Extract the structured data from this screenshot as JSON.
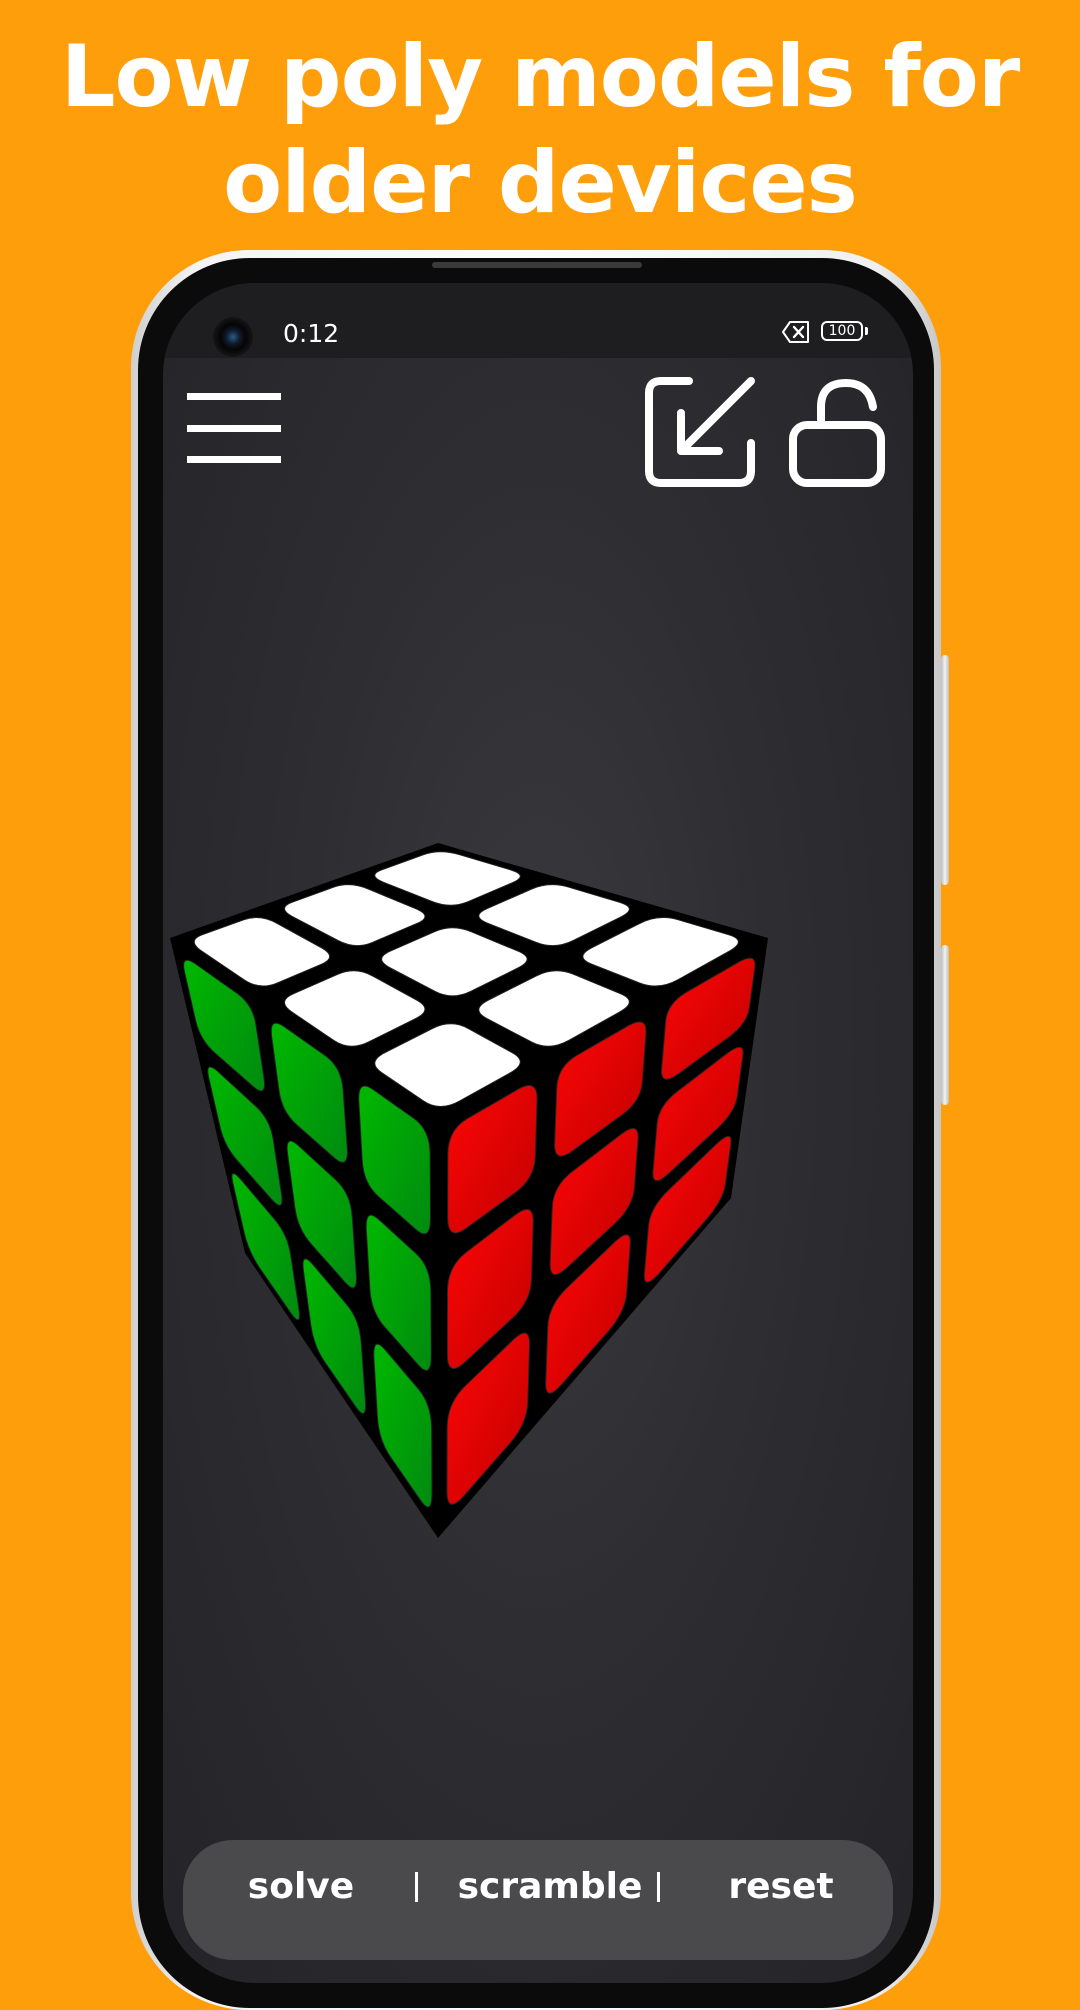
{
  "headline": {
    "line1": "Low poly models for",
    "line2": "older devices"
  },
  "status_bar": {
    "time": "0:12",
    "battery": "100",
    "icons": [
      "camera-icon",
      "no-sim-icon",
      "battery-icon"
    ]
  },
  "toolbar": {
    "icons": [
      "menu-icon",
      "exit-fullscreen-icon",
      "unlock-icon"
    ]
  },
  "cube": {
    "colors": {
      "top": "#ffffff",
      "left": "#00c800",
      "right": "#e60000",
      "gap": "#000000"
    }
  },
  "controls": {
    "solve": "solve",
    "scramble": "scramble",
    "reset": "reset"
  },
  "colors": {
    "background": "#FF9E0B",
    "screen": "#2e2e32",
    "control_bar": "#4a4a4d"
  }
}
